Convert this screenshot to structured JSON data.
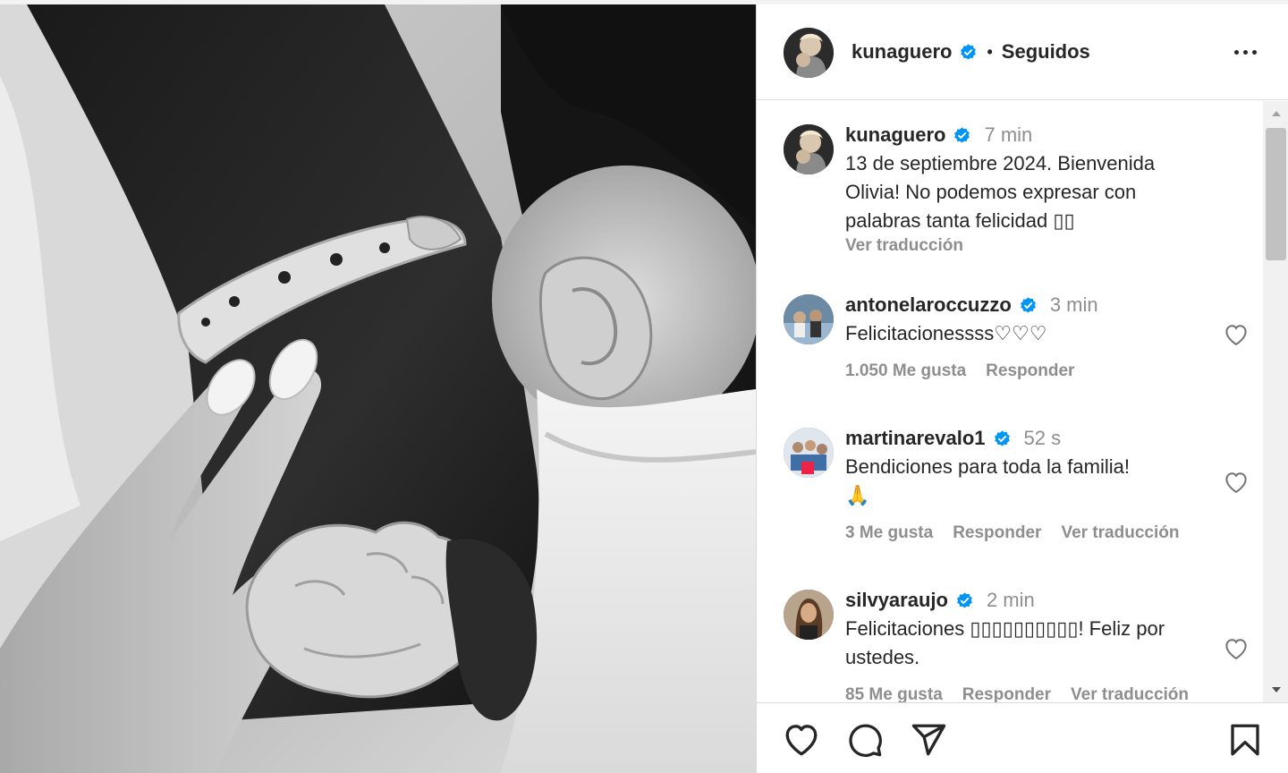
{
  "header": {
    "username": "kunaguero",
    "separator": "•",
    "follow_state": "Seguidos",
    "icons": {
      "avatar": "avatar",
      "verified": "verified-badge-icon",
      "more": "more-options-icon"
    }
  },
  "caption": {
    "username": "kunaguero",
    "time": "7 min",
    "text": "13 de septiembre 2024. Bienvenida Olivia! No podemos expresar con palabras tanta felicidad ▯▯",
    "translate_label": "Ver traducción"
  },
  "comments": [
    {
      "username": "antonelaroccuzzo",
      "time": "3 min",
      "text": "Felicitacionessss♡♡♡",
      "likes": "1.050 Me gusta",
      "reply_label": "Responder",
      "translate_label": ""
    },
    {
      "username": "martinarevalo1",
      "time": "52 s",
      "text": "Bendiciones para toda la familia!",
      "emoji": "🙏",
      "likes": "3 Me gusta",
      "reply_label": "Responder",
      "translate_label": "Ver traducción"
    },
    {
      "username": "silvyaraujo",
      "time": "2 min",
      "text": "Felicitaciones ▯▯▯▯▯▯▯▯▯▯! Feliz por ustedes.",
      "likes": "85 Me gusta",
      "reply_label": "Responder",
      "translate_label": "Ver traducción"
    }
  ],
  "actions": {
    "icons": [
      "heart-icon",
      "comment-icon",
      "share-icon",
      "bookmark-icon"
    ]
  },
  "colors": {
    "text": "#262626",
    "muted": "#8e8e8e",
    "verified": "#0095f6",
    "border": "#dbdbdb"
  }
}
